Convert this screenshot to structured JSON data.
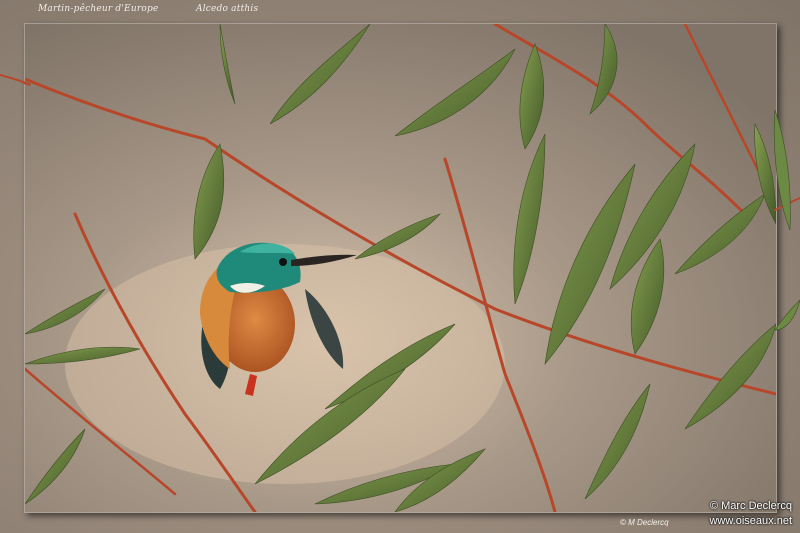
{
  "captions": {
    "common_name": "Martin-pêcheur d'Europe",
    "latin_name": "Alcedo atthis"
  },
  "credits": {
    "copyright": "© Marc Declercq",
    "website": "www.oiseaux.net",
    "small_credit": "© M Declercq"
  },
  "colors": {
    "background": "#8d7f72",
    "twig": "#b8472a",
    "leaf": "#5f7a3c",
    "bird_back": "#1f8a7a",
    "bird_breast": "#c8692b"
  }
}
